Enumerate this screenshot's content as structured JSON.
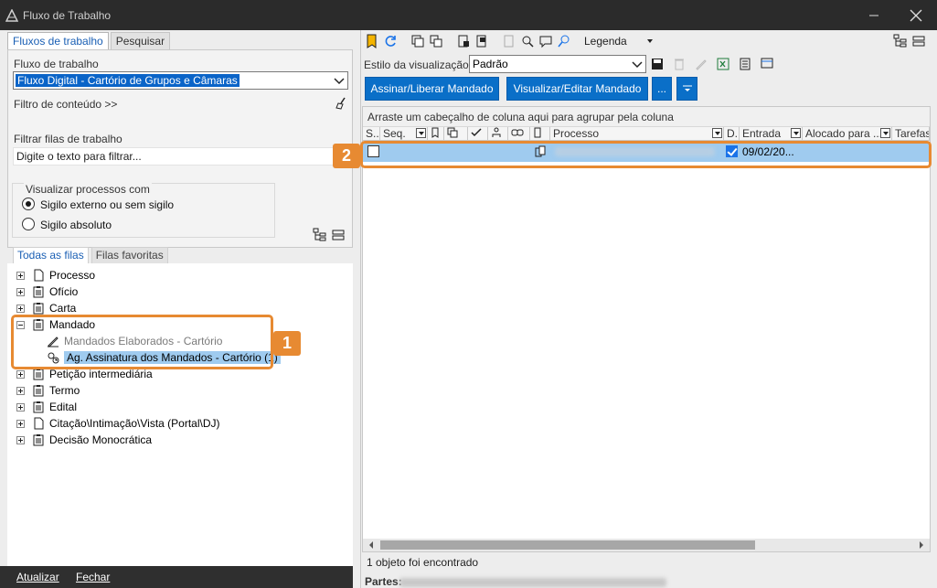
{
  "window": {
    "title": "Fluxo de Trabalho"
  },
  "left": {
    "tabs": [
      "Fluxos de trabalho",
      "Pesquisar"
    ],
    "fluxo_label": "Fluxo de trabalho",
    "fluxo_value": "Fluxo Digital - Cartório de Grupos e Câmaras",
    "filtro_conteudo": "Filtro de conteúdo >>",
    "filtrar_label": "Filtrar filas de trabalho",
    "filtrar_placeholder": "Digite o texto para filtrar...",
    "visualizar_group": "Visualizar processos com",
    "radio_1": "Sigilo externo ou sem sigilo",
    "radio_2": "Sigilo absoluto",
    "tabs2": [
      "Todas as filas",
      "Filas favoritas"
    ],
    "tree": {
      "processo": "Processo",
      "oficio": "Ofício",
      "carta": "Carta",
      "mandado": "Mandado",
      "mandados_elaborados": "Mandados Elaborados - Cartório",
      "ag_assinatura": "Ag. Assinatura dos Mandados - Cartório (1)",
      "peticao": "Petição intermediária",
      "termo": "Termo",
      "edital": "Edital",
      "citacao": "Citação\\Intimação\\Vista (Portal\\DJ)",
      "decisao": "Decisão Monocrática"
    },
    "bottom": {
      "atualizar": "Atualizar",
      "fechar": "Fechar"
    }
  },
  "right": {
    "legenda": "Legenda",
    "estilo_label": "Estilo da visualização",
    "estilo_value": "Padrão",
    "btn_assinar": "Assinar/Liberar Mandado",
    "btn_visualizar": "Visualizar/Editar Mandado",
    "btn_more": "...",
    "group_hint": "Arraste um cabeçalho de coluna aqui para agrupar pela coluna",
    "columns": {
      "s": "S...",
      "seq": "Seq.",
      "processo": "Processo",
      "d": "D.",
      "entrada": "Entrada",
      "alocado": "Alocado para ...",
      "tarefa": "Tarefas"
    },
    "row": {
      "entrada": "09/02/20..."
    },
    "status": "1 objeto foi encontrado",
    "partes_label": "Partes:"
  },
  "annotations": {
    "badge1": "1",
    "badge2": "2"
  },
  "colors": {
    "accent": "#0a6fc8",
    "annotation": "#e78a32",
    "selection": "#9fcbef"
  }
}
